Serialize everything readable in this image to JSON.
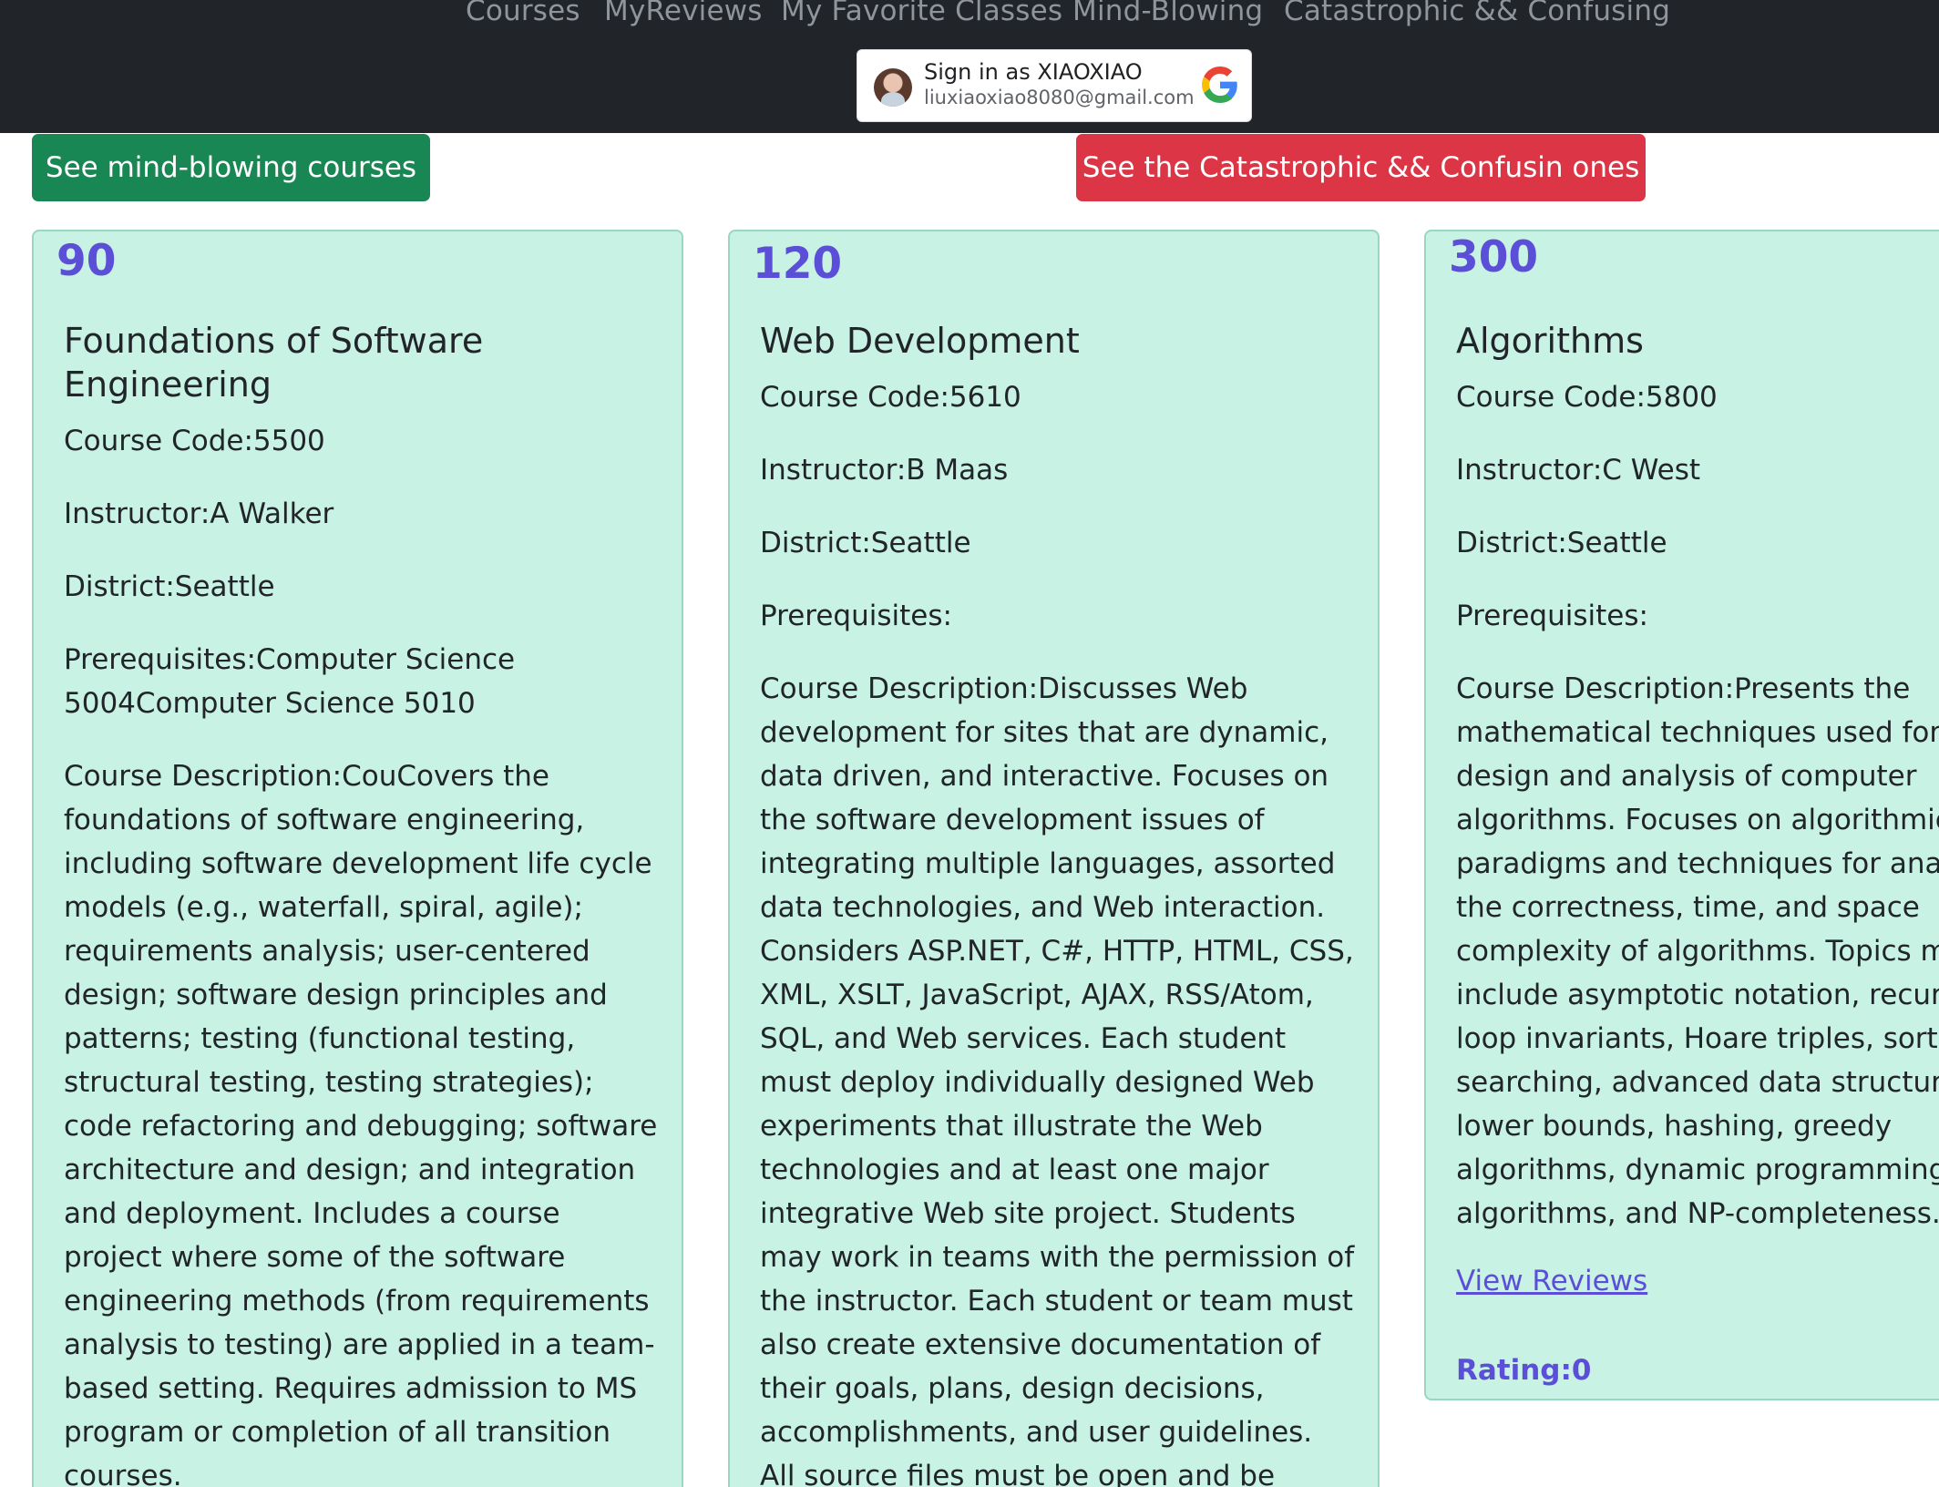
{
  "nav": {
    "links": [
      "Courses",
      "MyReviews",
      "My Favorite Classes",
      "Mind-Blowing",
      "Catastrophic && Confusing"
    ]
  },
  "signin": {
    "name": "Sign in as XIAOXIAO",
    "email": "liuxiaoxiao8080@gmail.com",
    "icon": "google-g-icon"
  },
  "buttons": {
    "mind_blowing": "See mind-blowing courses",
    "catastrophic": "See the Catastrophic && Confusin ones"
  },
  "colors": {
    "navbar": "#212529",
    "card_bg": "#c8f2e3",
    "accent": "#5b4fd8",
    "green": "#198754",
    "red": "#dc3545"
  },
  "courses": [
    {
      "number": "90",
      "title": "Foundations of Software Engineering",
      "code": "Course Code:5500",
      "instructor": "Instructor:A Walker",
      "district": "District:Seattle",
      "prereqs": "Prerequisites:Computer Science 5004Computer Science 5010",
      "description": "Course Description:CouCovers the foundations of software engineering, including software development life cycle models (e.g., waterfall, spiral, agile); requirements analysis; user-centered design; software design principles and patterns; testing (functional testing, structural testing, testing strategies); code refactoring and debugging; software architecture and design; and integration and deployment. Includes a course project where some of the software engineering methods (from requirements analysis to testing) are applied in a team-based setting. Requires admission to MS program or completion of all transition courses."
    },
    {
      "number": "120",
      "title": "Web Development",
      "code": "Course Code:5610",
      "instructor": "Instructor:B Maas",
      "district": "District:Seattle",
      "prereqs": "Prerequisites:",
      "description": "Course Description:Discusses Web development for sites that are dynamic, data driven, and interactive. Focuses on the software development issues of integrating multiple languages, assorted data technologies, and Web interaction. Considers ASP.NET, C#, HTTP, HTML, CSS, XML, XSLT, JavaScript, AJAX, RSS/Atom, SQL, and Web services. Each student must deploy individually designed Web experiments that illustrate the Web technologies and at least one major integrative Web site project. Students may work in teams with the permission of the instructor. Each student or team must also create extensive documentation of their goals, plans, design decisions, accomplishments, and user guidelines. All source files must be open and be"
    },
    {
      "number": "300",
      "title": "Algorithms",
      "code": "Course Code:5800",
      "instructor": "Instructor:C West",
      "district": "District:Seattle",
      "prereqs": "Prerequisites:",
      "description": "Course Description:Presents the mathematical techniques used for the design and analysis of computer algorithms. Focuses on algorithmic design paradigms and techniques for analyzing the correctness, time, and space complexity of algorithms. Topics may include asymptotic notation, recurrences, loop invariants, Hoare triples, sorting and searching, advanced data structures, lower bounds, hashing, greedy algorithms, dynamic programming, graph algorithms, and NP-completeness.",
      "reviews_link": "View Reviews",
      "rating": "Rating:0"
    }
  ]
}
